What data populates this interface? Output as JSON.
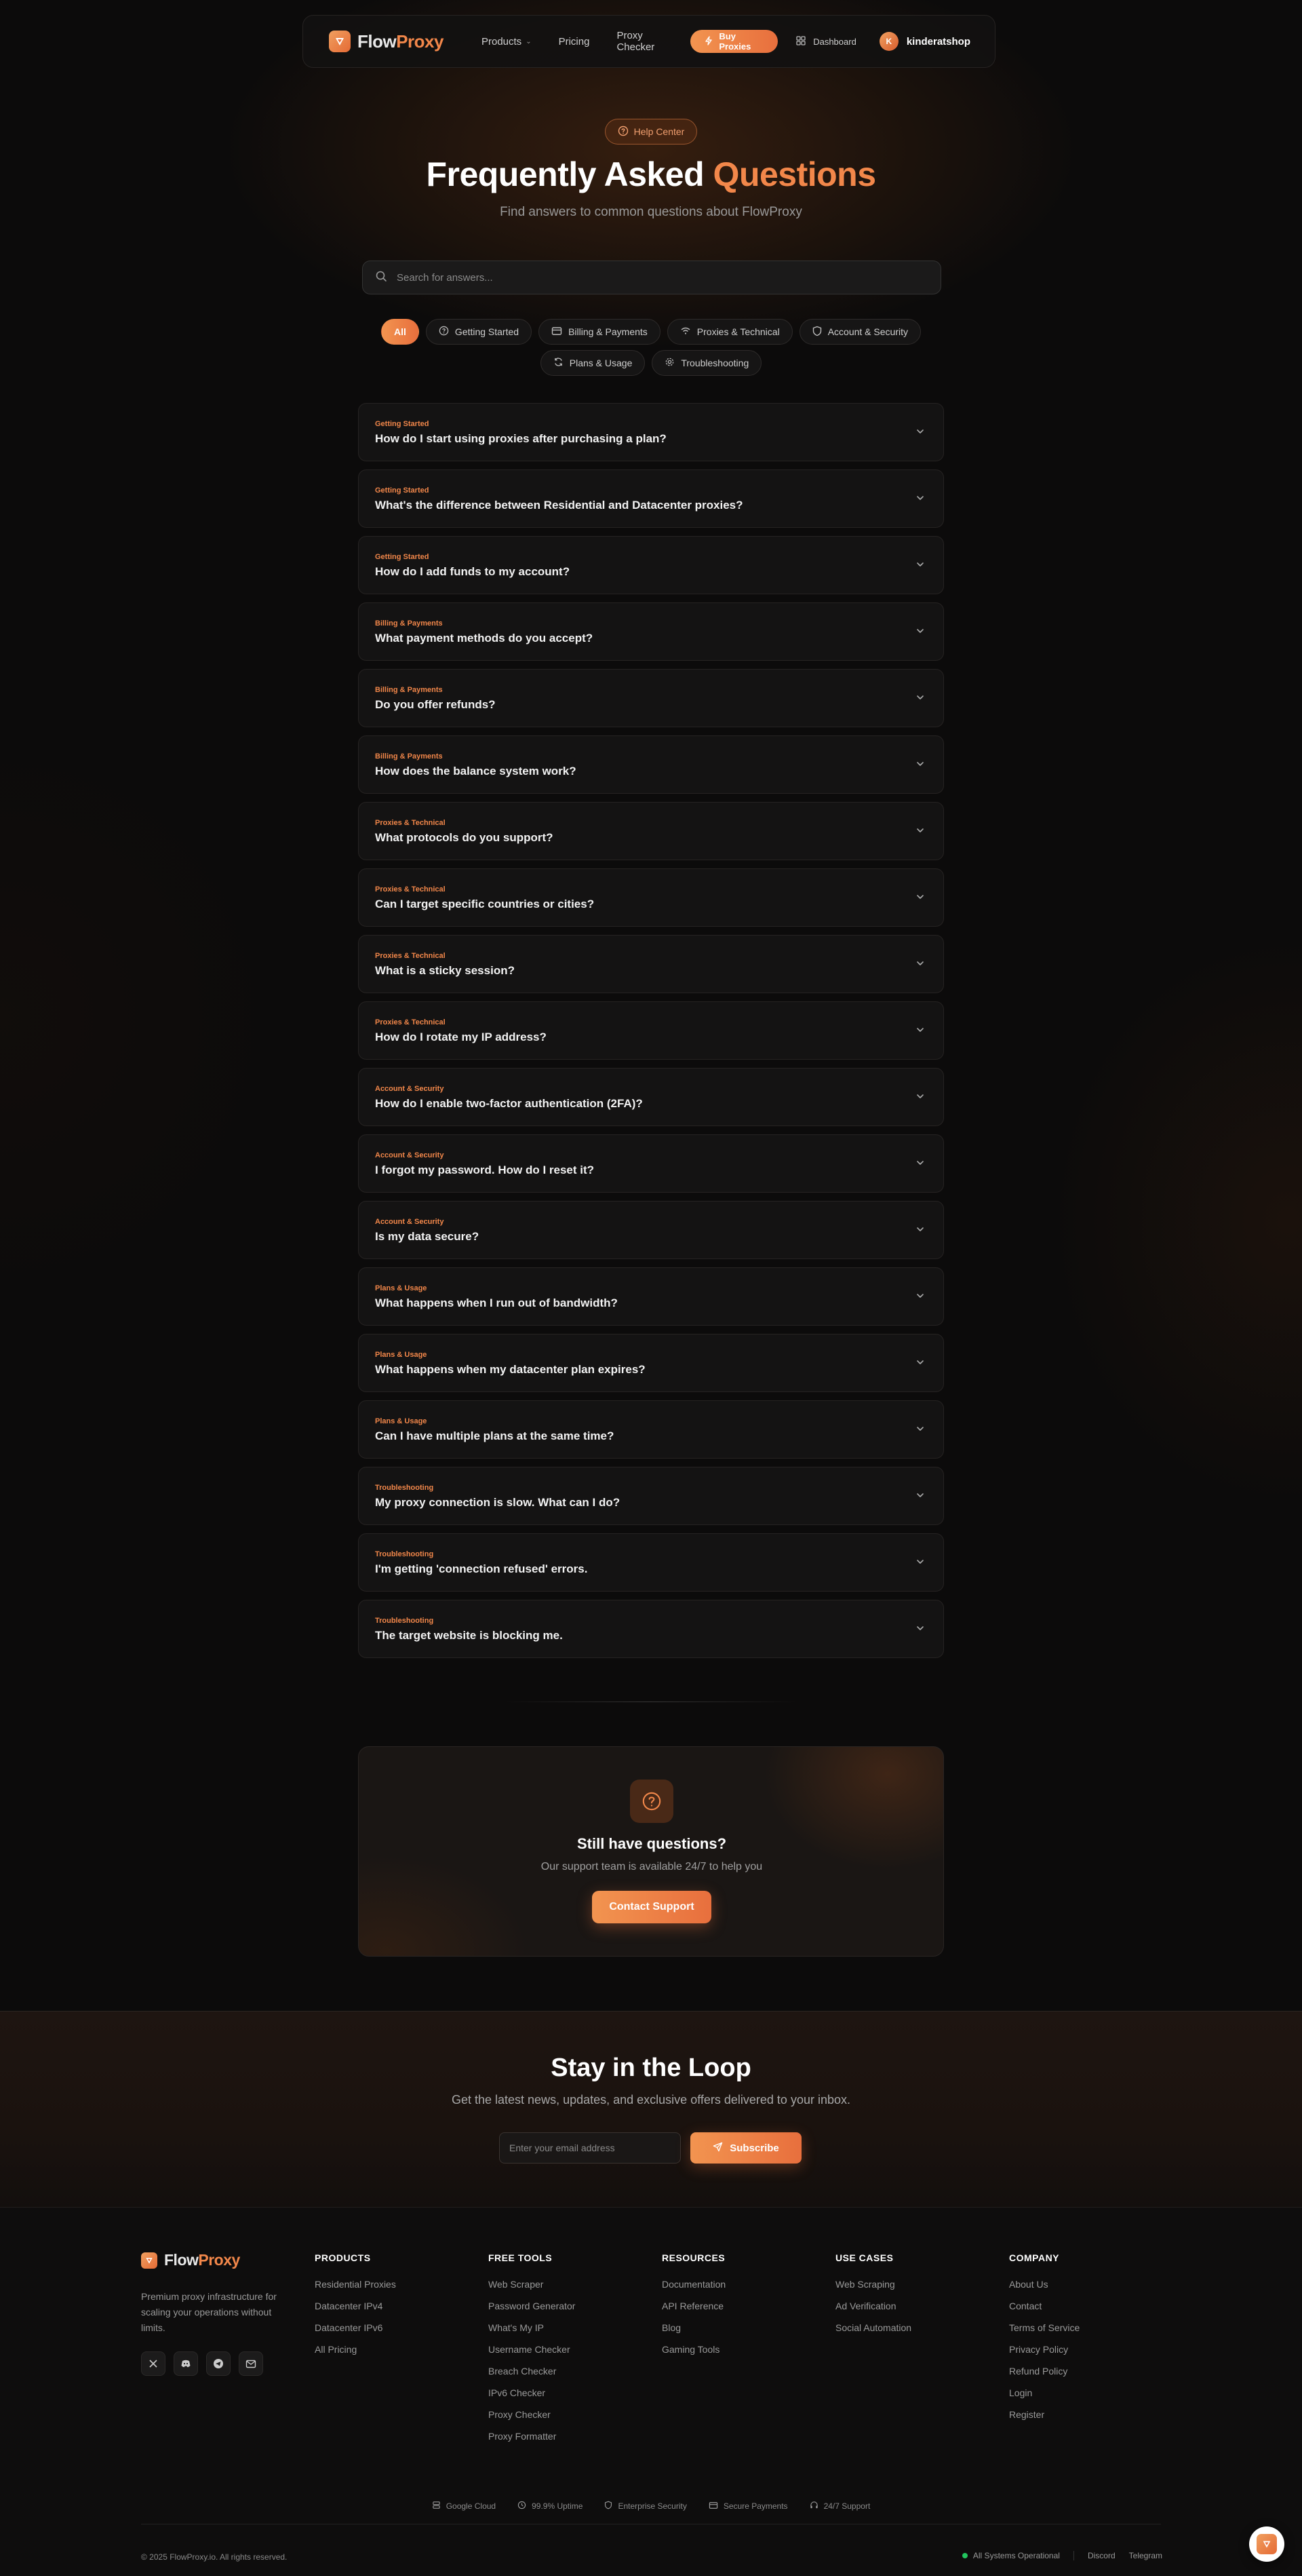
{
  "brand": {
    "name_part1": "Flow",
    "name_part2": "Proxy",
    "accent_color": "#f2874a"
  },
  "nav": {
    "products": "Products",
    "pricing": "Pricing",
    "proxy_checker": "Proxy Checker",
    "buy": "Buy Proxies",
    "dashboard": "Dashboard",
    "avatar_initial": "K",
    "username": "kinderatshop"
  },
  "hero": {
    "pill": "Help Center",
    "title_part1": "Frequently Asked ",
    "title_part2": "Questions",
    "subtitle": "Find answers to common questions about FlowProxy"
  },
  "search": {
    "placeholder": "Search for answers..."
  },
  "filters": {
    "all": "All",
    "getting_started": "Getting Started",
    "billing": "Billing & Payments",
    "proxies": "Proxies & Technical",
    "account": "Account & Security",
    "plans": "Plans & Usage",
    "troubleshooting": "Troubleshooting",
    "active": "All"
  },
  "faqs": [
    {
      "category": "Getting Started",
      "question": "How do I start using proxies after purchasing a plan?"
    },
    {
      "category": "Getting Started",
      "question": "What's the difference between Residential and Datacenter proxies?"
    },
    {
      "category": "Getting Started",
      "question": "How do I add funds to my account?"
    },
    {
      "category": "Billing & Payments",
      "question": "What payment methods do you accept?"
    },
    {
      "category": "Billing & Payments",
      "question": "Do you offer refunds?"
    },
    {
      "category": "Billing & Payments",
      "question": "How does the balance system work?"
    },
    {
      "category": "Proxies & Technical",
      "question": "What protocols do you support?"
    },
    {
      "category": "Proxies & Technical",
      "question": "Can I target specific countries or cities?"
    },
    {
      "category": "Proxies & Technical",
      "question": "What is a sticky session?"
    },
    {
      "category": "Proxies & Technical",
      "question": "How do I rotate my IP address?"
    },
    {
      "category": "Account & Security",
      "question": "How do I enable two-factor authentication (2FA)?"
    },
    {
      "category": "Account & Security",
      "question": "I forgot my password. How do I reset it?"
    },
    {
      "category": "Account & Security",
      "question": "Is my data secure?"
    },
    {
      "category": "Plans & Usage",
      "question": "What happens when I run out of bandwidth?"
    },
    {
      "category": "Plans & Usage",
      "question": "What happens when my datacenter plan expires?"
    },
    {
      "category": "Plans & Usage",
      "question": "Can I have multiple plans at the same time?"
    },
    {
      "category": "Troubleshooting",
      "question": "My proxy connection is slow. What can I do?"
    },
    {
      "category": "Troubleshooting",
      "question": "I'm getting 'connection refused' errors."
    },
    {
      "category": "Troubleshooting",
      "question": "The target website is blocking me."
    }
  ],
  "support": {
    "title": "Still have questions?",
    "subtitle": "Our support team is available 24/7 to help you",
    "button": "Contact Support"
  },
  "newsletter": {
    "title": "Stay in the Loop",
    "subtitle": "Get the latest news, updates, and exclusive offers delivered to your inbox.",
    "placeholder": "Enter your email address",
    "button": "Subscribe"
  },
  "footer": {
    "description": "Premium proxy infrastructure for scaling your operations without limits.",
    "columns": {
      "products": {
        "title": "PRODUCTS",
        "links": [
          "Residential Proxies",
          "Datacenter IPv4",
          "Datacenter IPv6",
          "All Pricing"
        ]
      },
      "tools": {
        "title": "FREE TOOLS",
        "links": [
          "Web Scraper",
          "Password Generator",
          "What's My IP",
          "Username Checker",
          "Breach Checker",
          "IPv6 Checker",
          "Proxy Checker",
          "Proxy Formatter"
        ]
      },
      "resources": {
        "title": "RESOURCES",
        "links": [
          "Documentation",
          "API Reference",
          "Blog",
          "Gaming Tools"
        ]
      },
      "use_cases": {
        "title": "USE CASES",
        "links": [
          "Web Scraping",
          "Ad Verification",
          "Social Automation"
        ]
      },
      "company": {
        "title": "COMPANY",
        "links": [
          "About Us",
          "Contact",
          "Terms of Service",
          "Privacy Policy",
          "Refund Policy",
          "Login",
          "Register"
        ]
      }
    },
    "trust": {
      "cloud": "Google Cloud",
      "uptime": "99.9% Uptime",
      "security": "Enterprise Security",
      "payments": "Secure Payments",
      "support": "24/7 Support"
    },
    "copyright": "© 2025 FlowProxy.io. All rights reserved.",
    "status": "All Systems Operational",
    "discord": "Discord",
    "telegram": "Telegram"
  },
  "icons": {
    "logo": "flowproxy-logo-icon",
    "help": "question-circle-icon",
    "search": "search-icon",
    "chevron": "chevron-down-icon",
    "send": "send-icon"
  }
}
